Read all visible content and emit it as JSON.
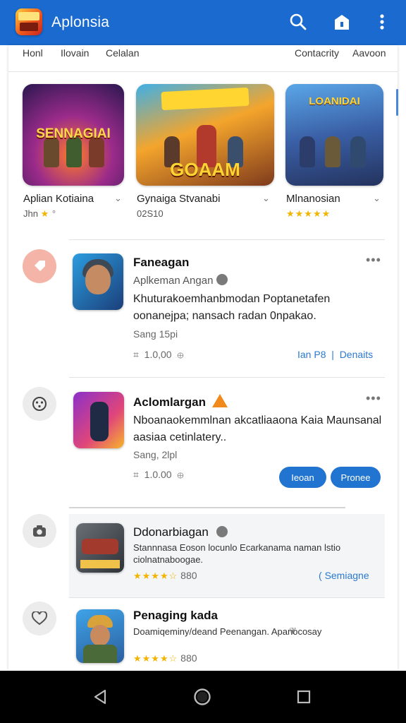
{
  "app": {
    "title": "Aplonsia"
  },
  "icons": {
    "logo": "app-logo-icon",
    "search": "search-icon",
    "store": "store-icon",
    "menu": "more-vert-icon"
  },
  "tabs": [
    "Honl",
    "Ilovain",
    "Celalan",
    "Contacrity",
    "Aavoon"
  ],
  "featured": [
    {
      "banner": "SENNAGIAI",
      "name": "Aplian Kotiaina",
      "meta": "Jhn",
      "rating": 1
    },
    {
      "banner": "GOAAM",
      "name": "Gynaiga Stvanabi",
      "meta": "02S10",
      "rating": 0
    },
    {
      "banner": "LOANIDAI",
      "name": "Mlnanosian",
      "meta": "",
      "rating": 5
    }
  ],
  "rows": [
    {
      "title": "Faneagan",
      "subtitle": "Aplkeman Angan",
      "desc": "Khuturakoemhanbmodan Poptanetafen oonanejpa; nansach radan 0npakao.",
      "date": "Sang 15pi",
      "stats": "1.0,00",
      "actions": [
        "Ian P8",
        "Denaits"
      ]
    },
    {
      "title": "Aclomlargan",
      "desc": "Nboanaokemmlnan akcatliaaona Kaia Maunsanal aasiaa cetinlatery..",
      "date": "Sang, 2lpl",
      "stats": "1.0.00",
      "buttons": [
        "Ieoan",
        "Pronee"
      ]
    },
    {
      "title": "Ddonarbiagan",
      "desc": "Stannnasa Eoson locunlo Ecarkanama naman lstio ciolnatnaboogae.",
      "rating": 4.5,
      "count": "880",
      "link": "Semiagne"
    },
    {
      "title": "Penaging kada",
      "desc": "Doamiqeminy/deand Peenangan. Apanocosay",
      "rating": 4.5,
      "count": "880"
    }
  ],
  "nav": {
    "back": "back-icon",
    "home": "home-icon",
    "recents": "recents-icon"
  }
}
